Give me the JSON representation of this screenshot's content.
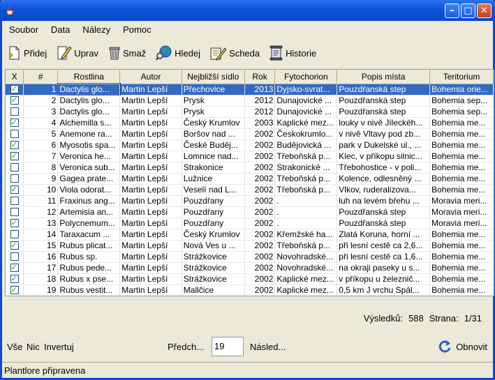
{
  "window": {
    "title": ""
  },
  "menu": {
    "items": [
      "Soubor",
      "Data",
      "Nálezy",
      "Pomoc"
    ]
  },
  "toolbar": {
    "add": "Přidej",
    "edit": "Uprav",
    "delete": "Smaž",
    "search": "Hledej",
    "sheet": "Scheda",
    "history": "Historie"
  },
  "table": {
    "columns": [
      "X",
      "#",
      "Rostlina",
      "Autor",
      "Nejbližší sídlo",
      "Rok",
      "Fytochorion",
      "Popis místa",
      "Teritorium"
    ],
    "rows": [
      {
        "checked": true,
        "num": "1",
        "plant": "Dactylis glo...",
        "author": "Martin Lepší",
        "place": "Přechovice",
        "year": "2013",
        "phyto": "Dyjsko-svrat...",
        "desc": "Pouzdřanská step",
        "terr": "Bohemia orie..."
      },
      {
        "checked": true,
        "num": "2",
        "plant": "Dactylis glo...",
        "author": "Martin Lepší",
        "place": "Prysk",
        "year": "2012",
        "phyto": "Dunajovické ...",
        "desc": "Pouzdřanská step",
        "terr": "Bohemia sep..."
      },
      {
        "checked": false,
        "num": "3",
        "plant": "Dactylis glo...",
        "author": "Martin Lepší",
        "place": "Prysk",
        "year": "2012",
        "phyto": "Dunajovické ...",
        "desc": "Pouzdřanská step",
        "terr": "Bohemia sep..."
      },
      {
        "checked": true,
        "num": "4",
        "plant": "Alchemilla s...",
        "author": "Martin Lepší",
        "place": "Český Krumlov",
        "year": "2003",
        "phyto": "Kaplické mez...",
        "desc": "louky v nivě Jíleckéh...",
        "terr": "Bohemia me..."
      },
      {
        "checked": false,
        "num": "5",
        "plant": "Anemone ra...",
        "author": "Martin Lepší",
        "place": "Boršov nad ...",
        "year": "2002",
        "phyto": "Českokrumlo...",
        "desc": "v nivě Vltavy pod zb...",
        "terr": "Bohemia me..."
      },
      {
        "checked": true,
        "num": "6",
        "plant": "Myosotis spa...",
        "author": "Martin Lepší",
        "place": "České Buděj...",
        "year": "2002",
        "phyto": "Budějovická ...",
        "desc": "park v Dukelské ul., ...",
        "terr": "Bohemia me..."
      },
      {
        "checked": true,
        "num": "7",
        "plant": "Veronica he...",
        "author": "Martin Lepší",
        "place": "Lomnice nad...",
        "year": "2002",
        "phyto": "Třeboňská p...",
        "desc": "Klec, v příkopu silnic...",
        "terr": "Bohemia me..."
      },
      {
        "checked": false,
        "num": "8",
        "plant": "Veronica sub...",
        "author": "Martin Lepší",
        "place": "Strakonice",
        "year": "2002",
        "phyto": "Strakonické ...",
        "desc": "Třebohostice - v poli...",
        "terr": "Bohemia me..."
      },
      {
        "checked": false,
        "num": "9",
        "plant": "Gagea prate...",
        "author": "Martin Lepší",
        "place": "Lužnice",
        "year": "2002",
        "phyto": "Třeboňská p...",
        "desc": "Kolence, odlesněný ...",
        "terr": "Bohemia me..."
      },
      {
        "checked": true,
        "num": "10",
        "plant": "Viola odorat...",
        "author": "Martin Lepší",
        "place": "Veselí nad L...",
        "year": "2002",
        "phyto": "Třeboňská p...",
        "desc": " Vlkov, ruderalizova...",
        "terr": "Bohemia me..."
      },
      {
        "checked": false,
        "num": "11",
        "plant": "Fraxinus ang...",
        "author": "Martin Lepší",
        "place": "Pouzdřany",
        "year": "2002",
        "phyto": ".",
        "desc": "luh na levém břehu ...",
        "terr": "Moravia meri..."
      },
      {
        "checked": false,
        "num": "12",
        "plant": "Artemisia an...",
        "author": "Martin Lepší",
        "place": "Pouzdřany",
        "year": "2002",
        "phyto": ".",
        "desc": "Pouzdřanská step",
        "terr": "Moravia meri..."
      },
      {
        "checked": true,
        "num": "13",
        "plant": "Polycnemum...",
        "author": "Martin Lepší",
        "place": "Pouzdřany",
        "year": "2002",
        "phyto": ".",
        "desc": "Pouzdřanská step",
        "terr": "Moravia meri..."
      },
      {
        "checked": false,
        "num": "14",
        "plant": "Taraxacum ...",
        "author": "Martin Lepší",
        "place": "Český Krumlov",
        "year": "2002",
        "phyto": "Křemžské ha...",
        "desc": "Zlatá Koruna, horní ...",
        "terr": "Bohemia me..."
      },
      {
        "checked": true,
        "num": "15",
        "plant": "Rubus plicat...",
        "author": "Martin Lepší",
        "place": "Nová Ves u ...",
        "year": "2002",
        "phyto": "Třeboňská p...",
        "desc": "při lesní cestě ca 2,6...",
        "terr": "Bohemia me..."
      },
      {
        "checked": false,
        "num": "16",
        "plant": "Rubus sp.",
        "author": "Martin Lepší",
        "place": "Strážkovice",
        "year": "2002",
        "phyto": "Novohradské...",
        "desc": "při lesní cestě ca 1,6...",
        "terr": "Bohemia me..."
      },
      {
        "checked": true,
        "num": "17",
        "plant": "Rubus pede...",
        "author": "Martin Lepší",
        "place": "Strážkovice",
        "year": "2002",
        "phyto": "Novohradské...",
        "desc": "na okraji paseky u s...",
        "terr": "Bohemia me..."
      },
      {
        "checked": true,
        "num": "18",
        "plant": "Rubus x pse...",
        "author": "Martin Lepší",
        "place": "Strážkovice",
        "year": "2002",
        "phyto": "Kaplické mez...",
        "desc": "v příkopu u železnič...",
        "terr": "Bohemia me..."
      },
      {
        "checked": true,
        "num": "19",
        "plant": "Rubus vestit...",
        "author": "Martin Lepší",
        "place": "Mallčice",
        "year": "2002",
        "phyto": "Kaplické mez...",
        "desc": "0,5 km J vrchu Spál...",
        "terr": "Bohemia me..."
      }
    ]
  },
  "results": {
    "label": "Výsledků:",
    "count": "588",
    "page_label": "Strana:",
    "page": "1/31"
  },
  "bottom": {
    "all": "Vše",
    "none": "Nic",
    "invert": "Invertuj",
    "prev": "Předch...",
    "page_size": "19",
    "next": "Násled...",
    "refresh": "Obnovit"
  },
  "status": {
    "text": "Plantlore připravena"
  }
}
